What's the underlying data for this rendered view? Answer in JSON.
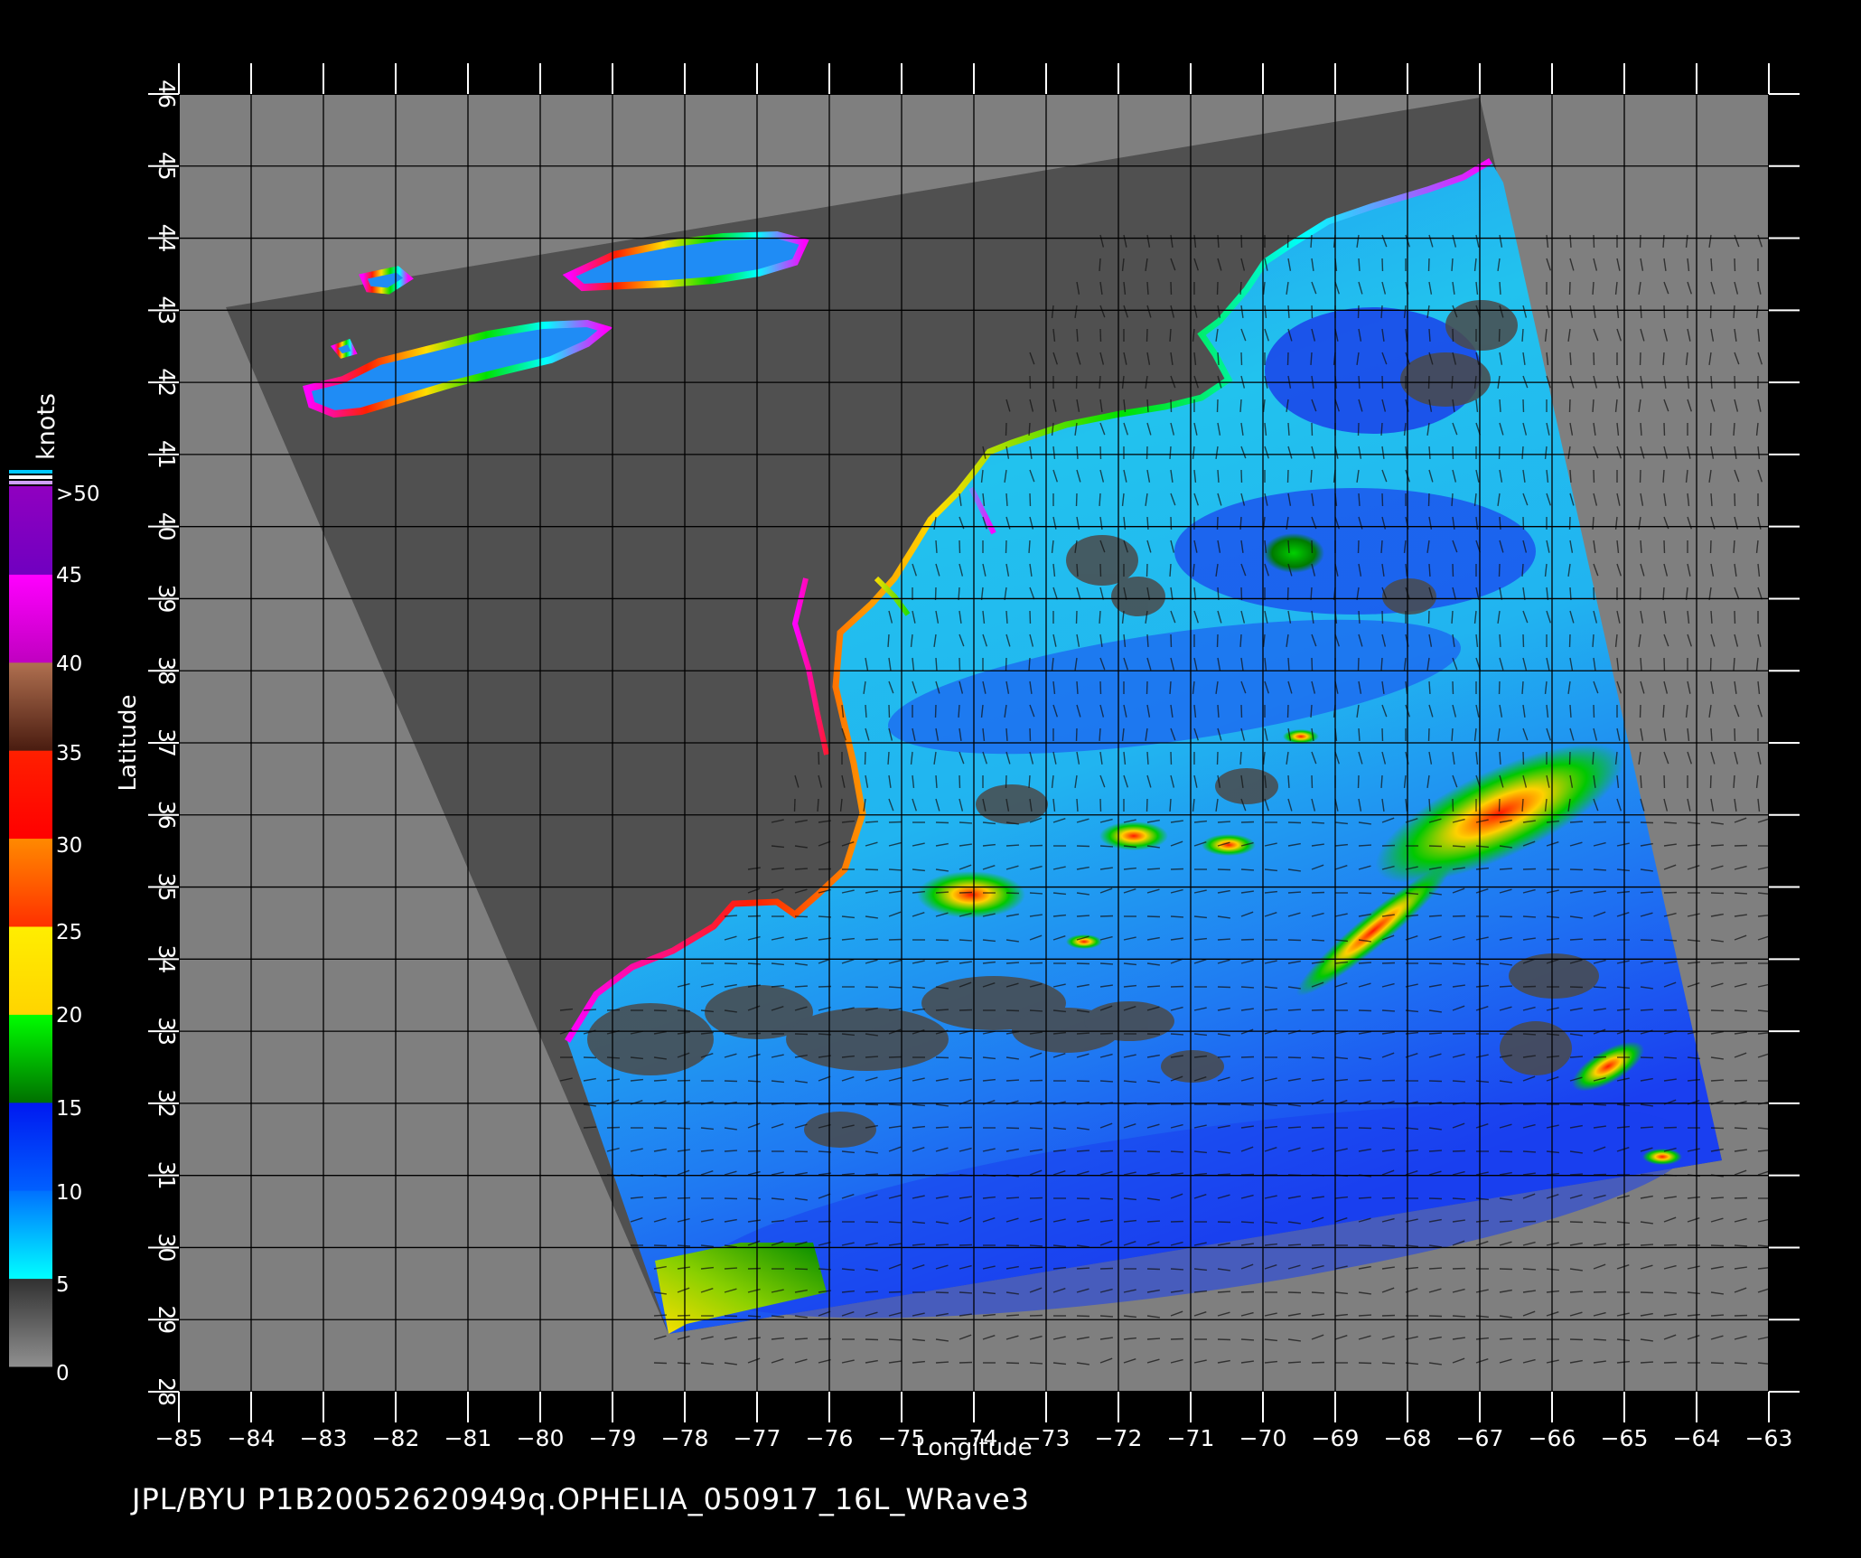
{
  "map": {
    "x_axis_label": "Longitude",
    "y_axis_label": "Latitude",
    "lon_ticks": [
      "-85",
      "-84",
      "-83",
      "-82",
      "-81",
      "-80",
      "-79",
      "-78",
      "-77",
      "-76",
      "-75",
      "-74",
      "-73",
      "-72",
      "-71",
      "-70",
      "-69",
      "-68",
      "-67",
      "-66",
      "-65",
      "-64",
      "-63"
    ],
    "lat_ticks": [
      "28",
      "29",
      "30",
      "31",
      "32",
      "33",
      "34",
      "35",
      "36",
      "37",
      "38",
      "39",
      "40",
      "41",
      "42",
      "43",
      "44",
      "45",
      "46"
    ],
    "lon_range": [
      -85,
      -63
    ],
    "lat_range": [
      28,
      46
    ],
    "colors": {
      "background": "#000000",
      "outside_swath": "#7f7f7f",
      "land_in_swath": "#505050",
      "grid": "#000000",
      "ocean_light": "#22c8f0",
      "ocean_mid": "#1f8cf5",
      "ocean_deep": "#1a3ff0"
    }
  },
  "legend": {
    "unit": "knots",
    "labels": [
      ">50",
      "45",
      "40",
      "35",
      "30",
      "25",
      "20",
      "15",
      "10",
      "5",
      "0"
    ],
    "bands": [
      {
        "from": 0,
        "to": 5,
        "colors": [
          "#909090",
          "#303030"
        ]
      },
      {
        "from": 5,
        "to": 10,
        "colors": [
          "#00ffff",
          "#0070ff"
        ]
      },
      {
        "from": 10,
        "to": 15,
        "colors": [
          "#0060ff",
          "#0018f0"
        ]
      },
      {
        "from": 15,
        "to": 20,
        "colors": [
          "#007000",
          "#00ff00"
        ]
      },
      {
        "from": 20,
        "to": 25,
        "colors": [
          "#ffd400",
          "#ffee00"
        ]
      },
      {
        "from": 25,
        "to": 30,
        "colors": [
          "#ff3000",
          "#ff8a00"
        ]
      },
      {
        "from": 30,
        "to": 35,
        "colors": [
          "#ff0000",
          "#ff2000"
        ]
      },
      {
        "from": 35,
        "to": 40,
        "colors": [
          "#4a1c10",
          "#b07050"
        ]
      },
      {
        "from": 40,
        "to": 45,
        "colors": [
          "#c000c0",
          "#ff00ff"
        ]
      },
      {
        "from": 45,
        "to": 50,
        "colors": [
          "#7000c0",
          "#9000c0"
        ]
      }
    ]
  },
  "footer": {
    "text": "JPL/BYU  P1B20052620949q.OPHELIA_050917_16L_WRave3"
  }
}
